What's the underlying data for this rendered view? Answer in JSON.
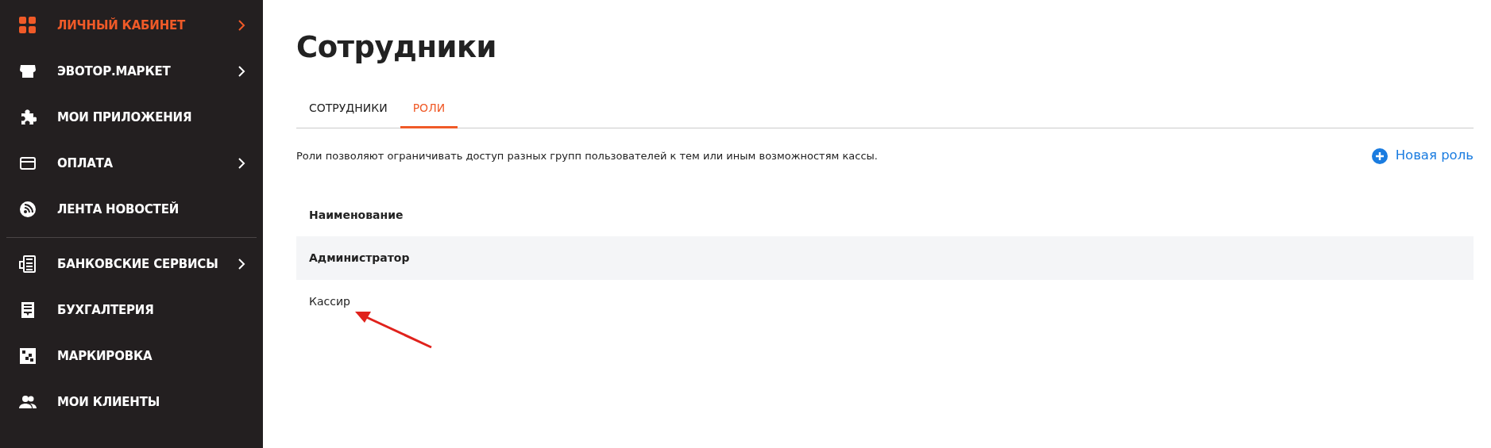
{
  "sidebar": {
    "groups": [
      {
        "items": [
          {
            "label": "ЛИЧНЫЙ КАБИНЕТ",
            "selected": true,
            "has_submenu": true
          },
          {
            "label": "ЭВОТОР.МАРКЕТ",
            "selected": false,
            "has_submenu": true
          },
          {
            "label": "МОИ ПРИЛОЖЕНИЯ",
            "selected": false,
            "has_submenu": false
          },
          {
            "label": "ОПЛАТА",
            "selected": false,
            "has_submenu": true
          },
          {
            "label": "ЛЕНТА НОВОСТЕЙ",
            "selected": false,
            "has_submenu": false
          }
        ]
      },
      {
        "items": [
          {
            "label": "БАНКОВСКИЕ СЕРВИСЫ",
            "selected": false,
            "has_submenu": true
          },
          {
            "label": "БУХГАЛТЕРИЯ",
            "selected": false,
            "has_submenu": false
          },
          {
            "label": "МАРКИРОВКА",
            "selected": false,
            "has_submenu": false
          },
          {
            "label": "МОИ КЛИЕНТЫ",
            "selected": false,
            "has_submenu": false
          }
        ]
      }
    ]
  },
  "page": {
    "title": "Сотрудники",
    "tabs": [
      {
        "label": "СОТРУДНИКИ",
        "selected": false
      },
      {
        "label": "РОЛИ",
        "selected": true
      }
    ],
    "description": "Роли позволяют ограничивать доступ разных групп пользователей к тем или иным возможностям кассы.",
    "new_button": "Новая роль",
    "table": {
      "columns": [
        "Наименование"
      ],
      "rows": [
        {
          "name": "Администратор",
          "highlighted": true
        },
        {
          "name": "Кассир",
          "highlighted": false
        }
      ]
    },
    "annotation": {
      "kind": "arrow"
    }
  }
}
